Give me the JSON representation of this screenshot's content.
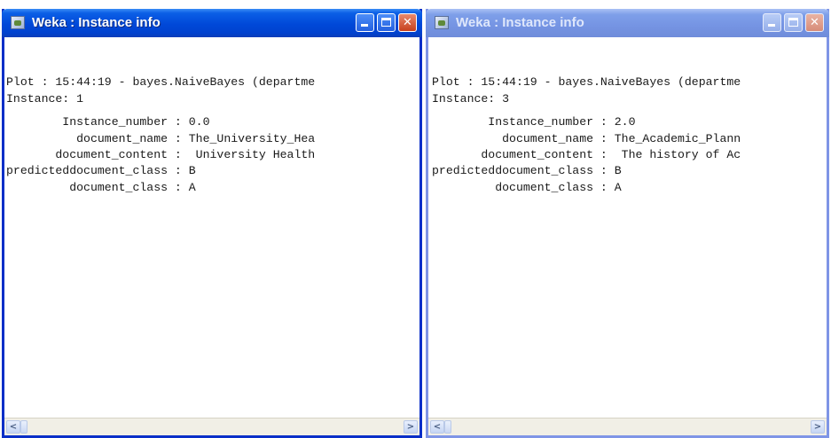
{
  "windows": [
    {
      "title": "Weka : Instance info",
      "lines": [
        "Plot : 15:44:19 - bayes.NaiveBayes (departme",
        "Instance: 1",
        "        Instance_number : 0.0",
        "          document_name : The_University_Hea",
        "       document_content :  University Health",
        "predicteddocument_class : B",
        "         document_class : A"
      ],
      "scroll_left_glyph": "<",
      "scroll_right_glyph": ">"
    },
    {
      "title": "Weka : Instance info",
      "lines": [
        "Plot : 15:44:19 - bayes.NaiveBayes (departme",
        "Instance: 3",
        "        Instance_number : 2.0",
        "          document_name : The_Academic_Plann",
        "       document_content :  The history of Ac",
        "predicteddocument_class : B",
        "         document_class : A"
      ],
      "scroll_left_glyph": "<",
      "scroll_right_glyph": ">"
    }
  ],
  "titlebar_buttons": {
    "close_glyph": "✕"
  },
  "icons": {
    "window_icon": "weka-app-icon",
    "minimize": "minimize-icon",
    "maximize": "maximize-icon",
    "close": "close-icon"
  },
  "colors": {
    "active_titlebar": "#0048d8",
    "inactive_titlebar": "#7594e3",
    "close_button": "#c7401d"
  }
}
